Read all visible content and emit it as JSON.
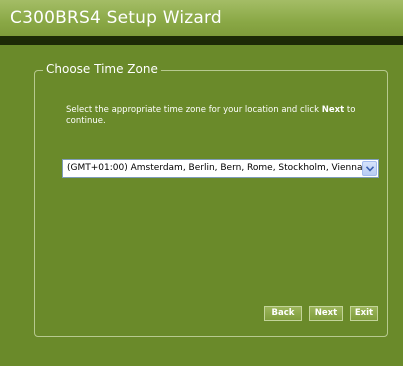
{
  "window": {
    "title": "C300BRS4 Setup Wizard"
  },
  "section": {
    "legend": "Choose Time Zone"
  },
  "instruction": {
    "prefix": "Select the appropriate time zone for your location and click ",
    "emphasis": "Next",
    "suffix": " to continue."
  },
  "timezone_select": {
    "selected": "(GMT+01:00) Amsterdam, Berlin, Bern, Rome, Stockholm, Vienna"
  },
  "buttons": {
    "back": "Back",
    "next": "Next",
    "exit": "Exit"
  },
  "icons": {
    "dropdown": "chevron-down-icon"
  },
  "colors": {
    "background": "#6a8a2a",
    "titlebar": "#8aa846",
    "darkbar": "#1d2a07",
    "text": "#ffffff"
  }
}
